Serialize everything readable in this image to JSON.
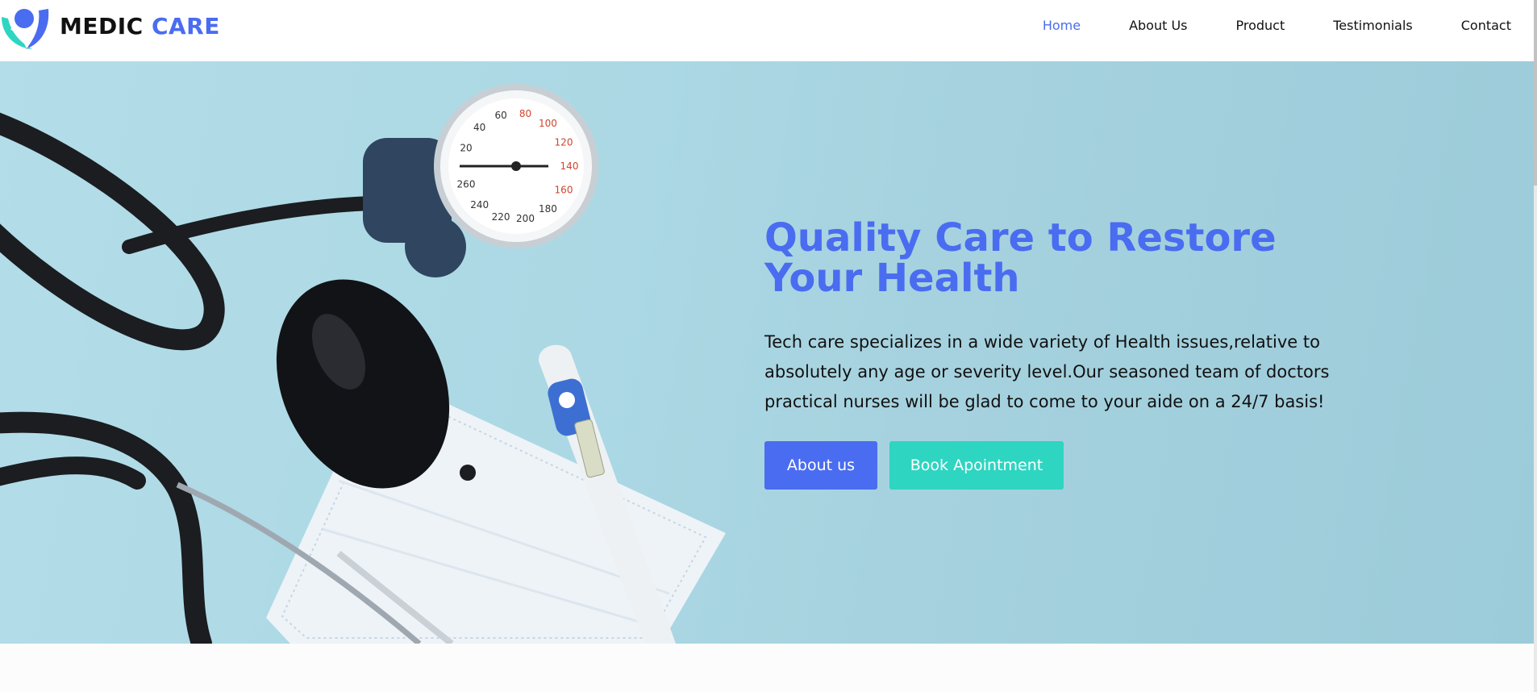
{
  "brand": {
    "word1": "MEDIC",
    "word2": "CARE"
  },
  "nav": {
    "items": [
      {
        "label": "Home",
        "active": true
      },
      {
        "label": "About Us",
        "active": false
      },
      {
        "label": "Product",
        "active": false
      },
      {
        "label": "Testimonials",
        "active": false
      },
      {
        "label": "Contact",
        "active": false
      }
    ]
  },
  "hero": {
    "title": "Quality Care to Restore Your Health",
    "description": "Tech care specializes in a wide variety of Health issues,relative to absolutely any age or severity level.Our seasoned team of doctors practical nurses will be glad to come to your aide on a 24/7 basis!",
    "primary_button": "About us",
    "secondary_button": "Book Apointment",
    "gauge_ticks": [
      "20",
      "40",
      "60",
      "80",
      "100",
      "120",
      "140",
      "160",
      "180",
      "200",
      "220",
      "240",
      "260"
    ]
  },
  "colors": {
    "accent": "#4a6cf0",
    "teal": "#2ed5c1",
    "hero_bg": "#abd8e4"
  },
  "icons": {
    "logo": "medic-care-logo-icon"
  }
}
